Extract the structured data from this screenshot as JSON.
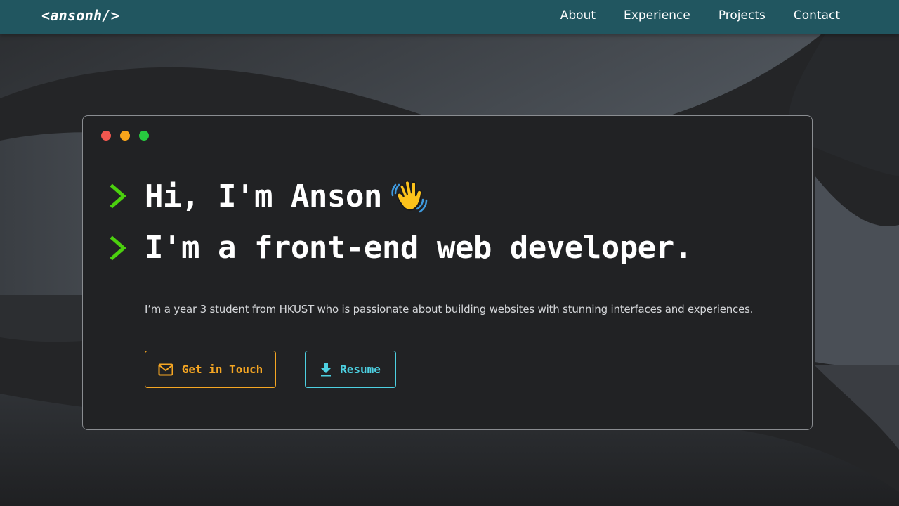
{
  "colors": {
    "navbar": "#215660",
    "accent_orange": "#f5a623",
    "accent_cyan": "#4dd0e1",
    "prompt_green": "#4bd00e",
    "terminal_bg": "#212224"
  },
  "navbar": {
    "logo": "<ansonh/>",
    "links": [
      {
        "label": "About"
      },
      {
        "label": "Experience"
      },
      {
        "label": "Projects"
      },
      {
        "label": "Contact"
      }
    ]
  },
  "terminal": {
    "window_dots": [
      "close",
      "minimize",
      "maximize"
    ],
    "line1": "Hi, I'm Anson",
    "line1_emoji_icon": "waving-hand-icon",
    "line2": "I'm a front-end web developer.",
    "prompt_icon": "chevron-right-icon",
    "bio": "I’m a year 3 student from HKUST who is passionate about building websites with stunning interfaces and experiences.",
    "buttons": {
      "contact_label": "Get in Touch",
      "contact_icon": "mail-icon",
      "resume_label": "Resume",
      "resume_icon": "download-icon"
    }
  }
}
